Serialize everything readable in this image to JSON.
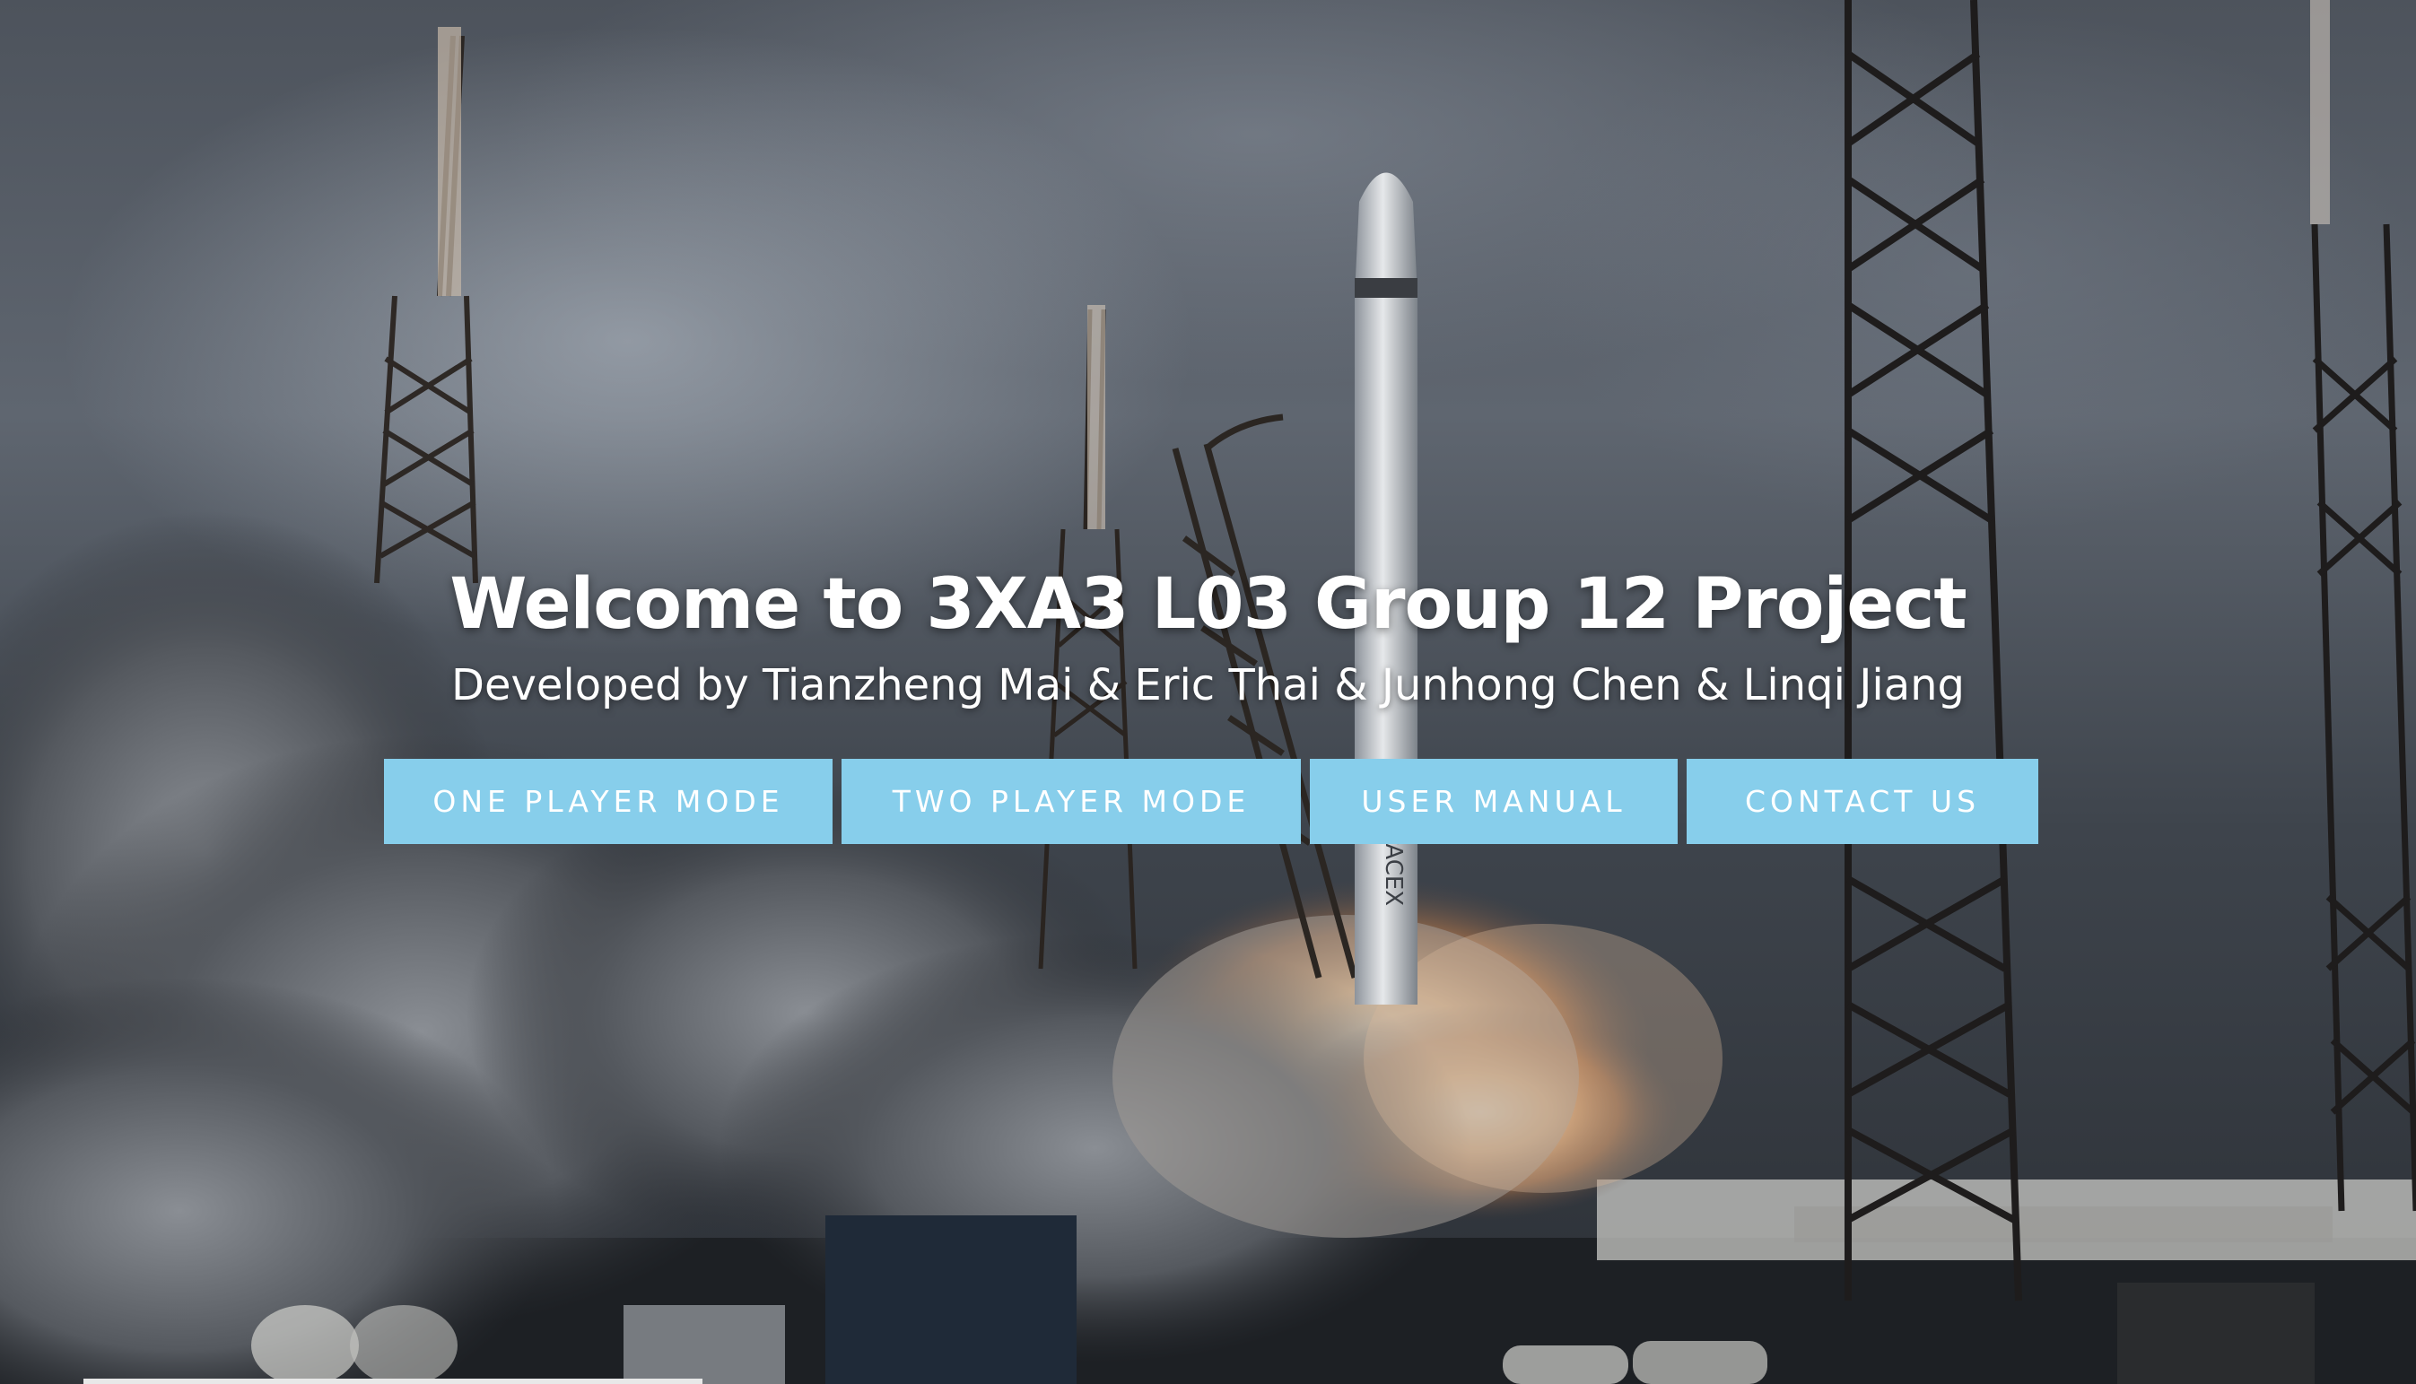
{
  "hero": {
    "title": "Welcome to 3XA3 L03 Group 12 Project",
    "subtitle": "Developed by Tianzheng Mai & Eric Thai & Junhong Chen & Linqi Jiang"
  },
  "nav": {
    "buttons": [
      {
        "label": "ONE PLAYER MODE"
      },
      {
        "label": "TWO PLAYER MODE"
      },
      {
        "label": "USER MANUAL"
      },
      {
        "label": "CONTACT US"
      }
    ]
  },
  "background": {
    "rocket_label": "SPACEX"
  },
  "colors": {
    "button_bg": "#87ceeb",
    "button_text": "#ffffff",
    "title_text": "#ffffff"
  }
}
